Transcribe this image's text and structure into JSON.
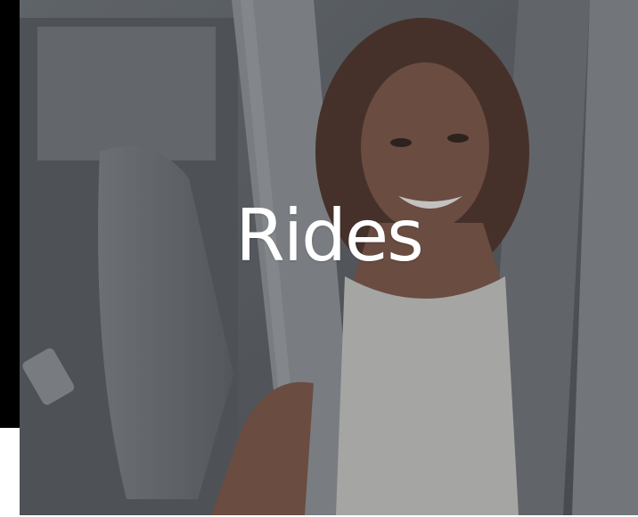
{
  "hero": {
    "title": "Rides",
    "image_description_icon": "person-in-car-photo"
  },
  "colors": {
    "title": "#ffffff",
    "overlay": "#3b3f44"
  }
}
